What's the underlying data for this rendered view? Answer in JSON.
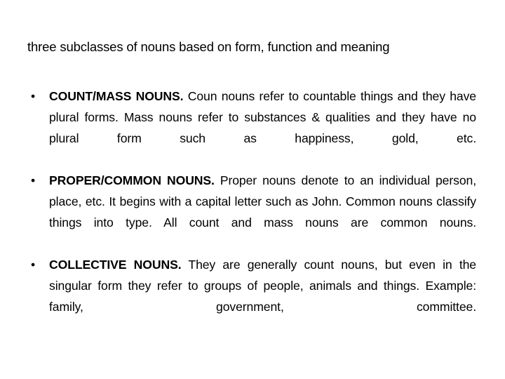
{
  "slide": {
    "background_color": "#ffffff",
    "text_color": "#000000",
    "title": "three subclasses of nouns based on form, function and meaning",
    "bullet_marker": "•",
    "bullets": [
      {
        "label": "COUNT/MASS NOUNS.",
        "text": " Coun nouns refer to countable things and they have plural forms. Mass nouns refer to substances & qualities and they have no plural form such as happiness, gold, etc."
      },
      {
        "label": "PROPER/COMMON NOUNS.",
        "text": " Proper nouns denote to an individual person, place, etc. It begins with a capital letter such as John. Common nouns classify things into type. All count and mass nouns are common nouns."
      },
      {
        "label": "COLLECTIVE NOUNS.",
        "text": " They are generally count nouns, but even in the singular form they refer to groups of people, animals and things. Example: family, government, committee."
      }
    ]
  }
}
